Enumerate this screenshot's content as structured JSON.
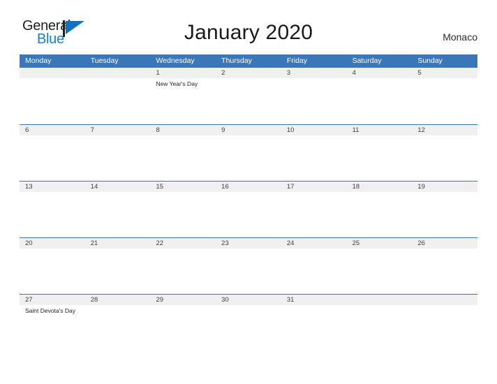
{
  "brand": {
    "word_one": "General",
    "word_two": "Blue",
    "flag_icon": "flag-triangle-icon",
    "accent_blue": "#1472b8",
    "text_dark": "#231f20"
  },
  "header": {
    "title": "January 2020",
    "country": "Monaco",
    "header_blue": "#3a76b8",
    "band_gray": "#f0f0f0"
  },
  "weekdays": [
    "Monday",
    "Tuesday",
    "Wednesday",
    "Thursday",
    "Friday",
    "Saturday",
    "Sunday"
  ],
  "weeks": [
    {
      "days": [
        {
          "date": "",
          "events": []
        },
        {
          "date": "",
          "events": []
        },
        {
          "date": "1",
          "events": [
            "New Year's Day"
          ]
        },
        {
          "date": "2",
          "events": []
        },
        {
          "date": "3",
          "events": []
        },
        {
          "date": "4",
          "events": []
        },
        {
          "date": "5",
          "events": []
        }
      ]
    },
    {
      "days": [
        {
          "date": "6",
          "events": []
        },
        {
          "date": "7",
          "events": []
        },
        {
          "date": "8",
          "events": []
        },
        {
          "date": "9",
          "events": []
        },
        {
          "date": "10",
          "events": []
        },
        {
          "date": "11",
          "events": []
        },
        {
          "date": "12",
          "events": []
        }
      ]
    },
    {
      "days": [
        {
          "date": "13",
          "events": []
        },
        {
          "date": "14",
          "events": []
        },
        {
          "date": "15",
          "events": []
        },
        {
          "date": "16",
          "events": []
        },
        {
          "date": "17",
          "events": []
        },
        {
          "date": "18",
          "events": []
        },
        {
          "date": "19",
          "events": []
        }
      ]
    },
    {
      "days": [
        {
          "date": "20",
          "events": []
        },
        {
          "date": "21",
          "events": []
        },
        {
          "date": "22",
          "events": []
        },
        {
          "date": "23",
          "events": []
        },
        {
          "date": "24",
          "events": []
        },
        {
          "date": "25",
          "events": []
        },
        {
          "date": "26",
          "events": []
        }
      ]
    },
    {
      "days": [
        {
          "date": "27",
          "events": [
            "Saint Devota's Day"
          ]
        },
        {
          "date": "28",
          "events": []
        },
        {
          "date": "29",
          "events": []
        },
        {
          "date": "30",
          "events": []
        },
        {
          "date": "31",
          "events": []
        },
        {
          "date": "",
          "events": []
        },
        {
          "date": "",
          "events": []
        }
      ]
    }
  ]
}
